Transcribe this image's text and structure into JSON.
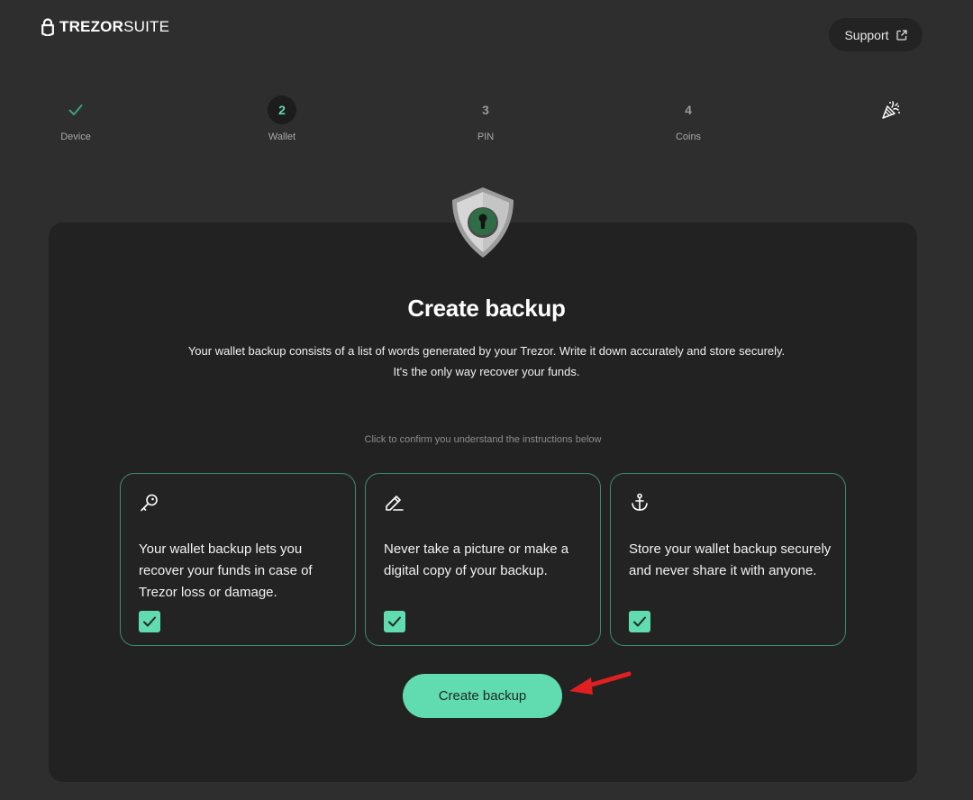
{
  "header": {
    "logo_brand": "TREZOR",
    "logo_suffix": "SUITE",
    "support_label": "Support"
  },
  "stepper": {
    "steps": [
      {
        "label": "Device",
        "number": "",
        "state": "done"
      },
      {
        "label": "Wallet",
        "number": "2",
        "state": "active"
      },
      {
        "label": "PIN",
        "number": "3",
        "state": "pending"
      },
      {
        "label": "Coins",
        "number": "4",
        "state": "pending"
      },
      {
        "label": "",
        "number": "",
        "state": "final",
        "icon": "party-popper-icon"
      }
    ]
  },
  "main": {
    "title": "Create backup",
    "description_line1": "Your wallet backup consists of a list of words generated by your Trezor. Write it down accurately and store securely.",
    "description_line2": "It's the only way recover your funds.",
    "hint": "Click to confirm you understand the instructions below",
    "tiles": [
      {
        "icon": "key-icon",
        "text": "Your wallet backup lets you recover your funds in case of Trezor loss or damage.",
        "checked": true
      },
      {
        "icon": "pencil-icon",
        "text": "Never take a picture or make a digital copy of your backup.",
        "checked": true
      },
      {
        "icon": "anchor-icon",
        "text": "Store your wallet backup securely and never share it with anyone.",
        "checked": true
      }
    ],
    "cta_label": "Create backup"
  },
  "colors": {
    "accent": "#61dbb0",
    "background": "#2e2e2e",
    "card": "#222222",
    "annotation_arrow": "#e02020"
  }
}
